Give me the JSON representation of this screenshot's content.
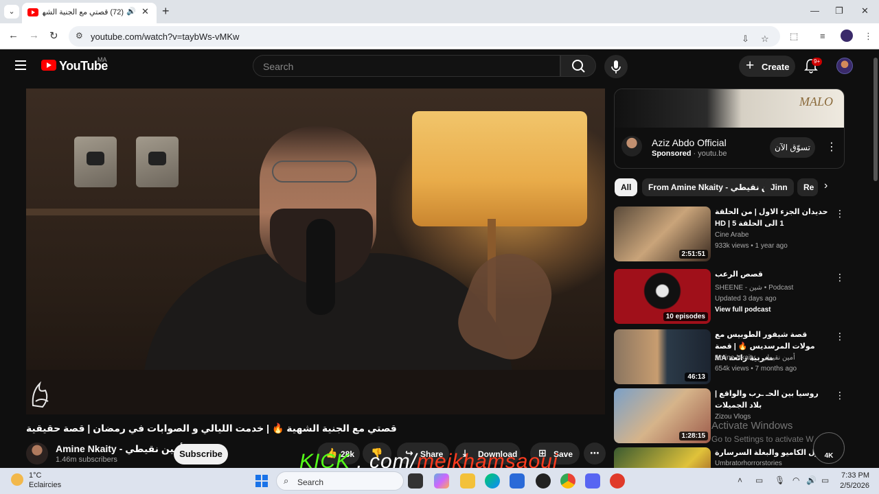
{
  "browser": {
    "tab_title": "(72) قصتي مع الجنية الشهية",
    "tab_close": "✕",
    "new_tab": "+",
    "url": "youtube.com/watch?v=taybWs-vMKw"
  },
  "header": {
    "logo_text": "YouTube",
    "country_code": "MA",
    "search_placeholder": "Search",
    "create_label": "Create",
    "notification_count": "9+"
  },
  "video": {
    "title": "قصتي مع الجنية الشهية 🔥 | خدمت الليالي و الصوابات في رمضان | قصة حقيقية",
    "channel_name": "Amine Nkaity - أمين نقيطي",
    "subscribers": "1.46m subscribers",
    "subscribe_label": "Subscribe",
    "likes": "28k",
    "share_label": "Share",
    "download_label": "Download",
    "save_label": "Save"
  },
  "ad": {
    "banner_text": "MALO",
    "title": "Aziz Abdo Official",
    "sponsored_label": "Sponsored",
    "domain": "youtu.be",
    "cta": "تسوّق الآن"
  },
  "chips": [
    "All",
    "From Amine Nkaity - أمين نقيطي",
    "Jinn",
    "Re"
  ],
  "recommendations": [
    {
      "title": "حديدان الجزء الاول | من الحلقة 1 الى الحلقة HD | 5",
      "channel": "Cine Arabe",
      "meta": "933k views • 1 year ago",
      "extra": "",
      "duration": "2:51:51"
    },
    {
      "title": "قصص الرعب",
      "channel": "SHEENE - شين • Podcast",
      "meta": "Updated 3 days ago",
      "extra": "View full podcast",
      "duration": "10 episodes"
    },
    {
      "title": "قصة شيفور الطوبيس مع مولات المرسديس 🔥 | قصة مغربية رائعة MA",
      "channel": "Amine Nkaity - أمين نقيطي",
      "meta": "654k views • 7 months ago",
      "extra": "",
      "duration": "46:13"
    },
    {
      "title": "روسيا بين الحـ ـرب والواقع | بلاد الجميلات",
      "channel": "Zizou Vlogs",
      "meta": "",
      "extra": "",
      "duration": "1:28:15"
    },
    {
      "title": "مول الكاميو والبغلة السرسارة",
      "channel": "Umbratorhorrorstories",
      "meta": "",
      "extra": "",
      "duration": ""
    }
  ],
  "overlays": {
    "activate_title": "Activate Windows",
    "activate_sub": "Go to Settings to activate W",
    "badge_label": "4K",
    "kick_part1": "KICK",
    "kick_part2": ". com/",
    "kick_part3": "meikhamsaoui"
  },
  "taskbar": {
    "temperature": "1°C",
    "weather": "Eclaircies",
    "search_label": "Search",
    "time": "7:33 PM",
    "date": "2/5/2026"
  }
}
